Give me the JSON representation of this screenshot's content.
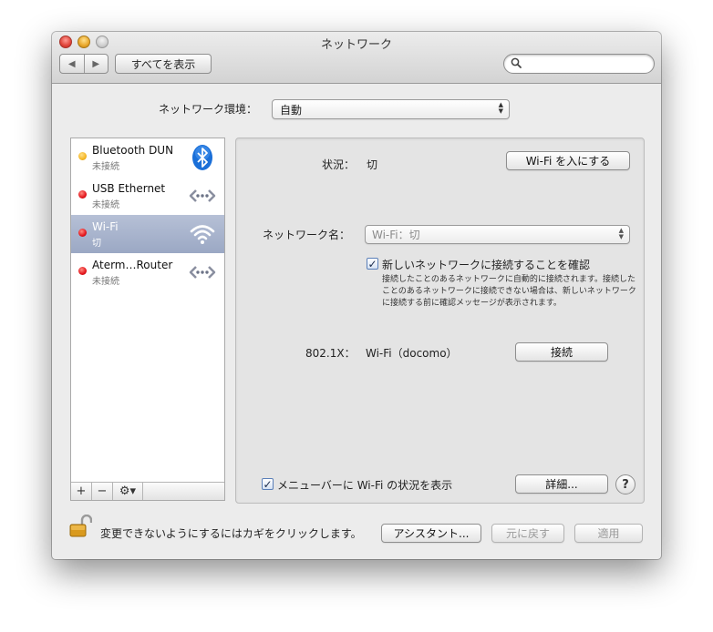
{
  "window": {
    "title": "ネットワーク"
  },
  "toolbar": {
    "back_icon": "◀",
    "forward_icon": "▶",
    "show_all_label": "すべてを表示",
    "search_icon": "⚲",
    "search_placeholder": ""
  },
  "location": {
    "label": "ネットワーク環境：",
    "value": "自動"
  },
  "services": [
    {
      "name": "Bluetooth DUN",
      "status": "未接続",
      "status_color": "#f5b623",
      "icon": "bluetooth-icon"
    },
    {
      "name": "USB Ethernet",
      "status": "未接続",
      "status_color": "#e3141b",
      "icon": "ethernet-icon"
    },
    {
      "name": "Wi-Fi",
      "status": "切",
      "status_color": "#e3141b",
      "icon": "wifi-icon",
      "selected": true
    },
    {
      "name": "Aterm…Router",
      "status": "未接続",
      "status_color": "#e3141b",
      "icon": "ethernet-icon"
    }
  ],
  "sidebar_buttons": {
    "add": "+",
    "remove": "−",
    "action": "⚙▾"
  },
  "detail": {
    "status_label": "状況：",
    "status_value": "切",
    "turn_on_button": "Wi-Fi を入にする",
    "network_name_label": "ネットワーク名：",
    "network_name_value": "Wi-Fi：切",
    "ask_join_label": "新しいネットワークに接続することを確認",
    "ask_join_checked": true,
    "ask_join_note": "接続したことのあるネットワークに自動的に接続されます。接続したことのあるネットワークに接続できない場合は、新しいネットワークに接続する前に確認メッセージが表示されます。",
    "dot1x_label": "802.1X：",
    "dot1x_value": "Wi-Fi（docomo）",
    "connect_button": "接続",
    "show_menubar_label": "メニューバーに Wi-Fi の状況を表示",
    "show_menubar_checked": true,
    "advanced_button": "詳細...",
    "help_label": "?"
  },
  "footer": {
    "lock_text": "変更できないようにするにはカギをクリックします。",
    "assistant_button": "アシスタント...",
    "revert_button": "元に戻す",
    "apply_button": "適用"
  }
}
